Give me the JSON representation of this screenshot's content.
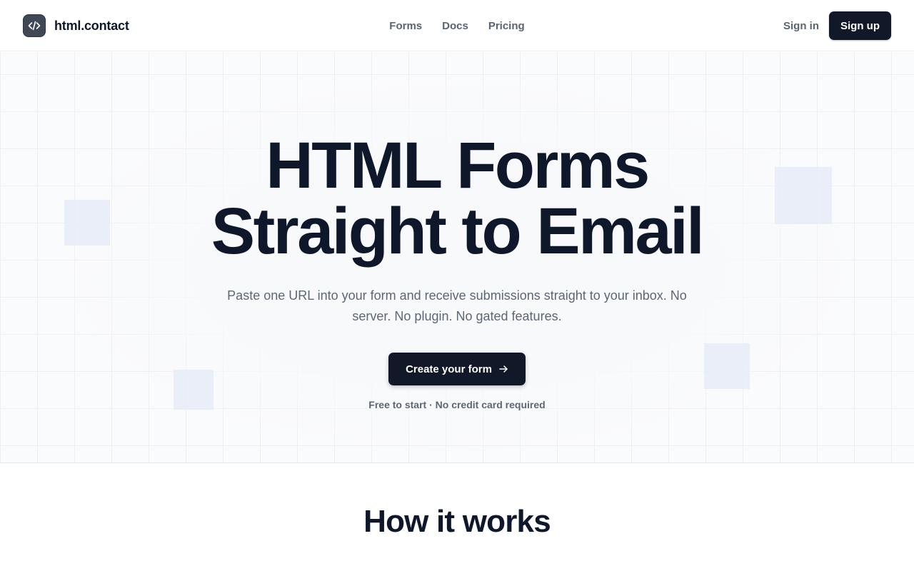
{
  "header": {
    "brand_name": "html.contact",
    "nav": [
      {
        "label": "Forms"
      },
      {
        "label": "Docs"
      },
      {
        "label": "Pricing"
      }
    ],
    "signin_label": "Sign in",
    "signup_label": "Sign up"
  },
  "hero": {
    "title_line1": "HTML Forms",
    "title_line2": "Straight to Email",
    "subtitle": "Paste one URL into your form and receive submissions straight to your inbox. No server. No plugin. No gated features.",
    "cta_label": "Create your form",
    "note": "Free to start · No credit card required"
  },
  "how_it_works": {
    "title": "How it works"
  },
  "icons": {
    "brand": "code-icon",
    "cta": "arrow-right-icon"
  },
  "colors": {
    "primary": "#111827",
    "text": "#0f172a",
    "muted": "#5d6675",
    "nav": "#5b6472"
  }
}
